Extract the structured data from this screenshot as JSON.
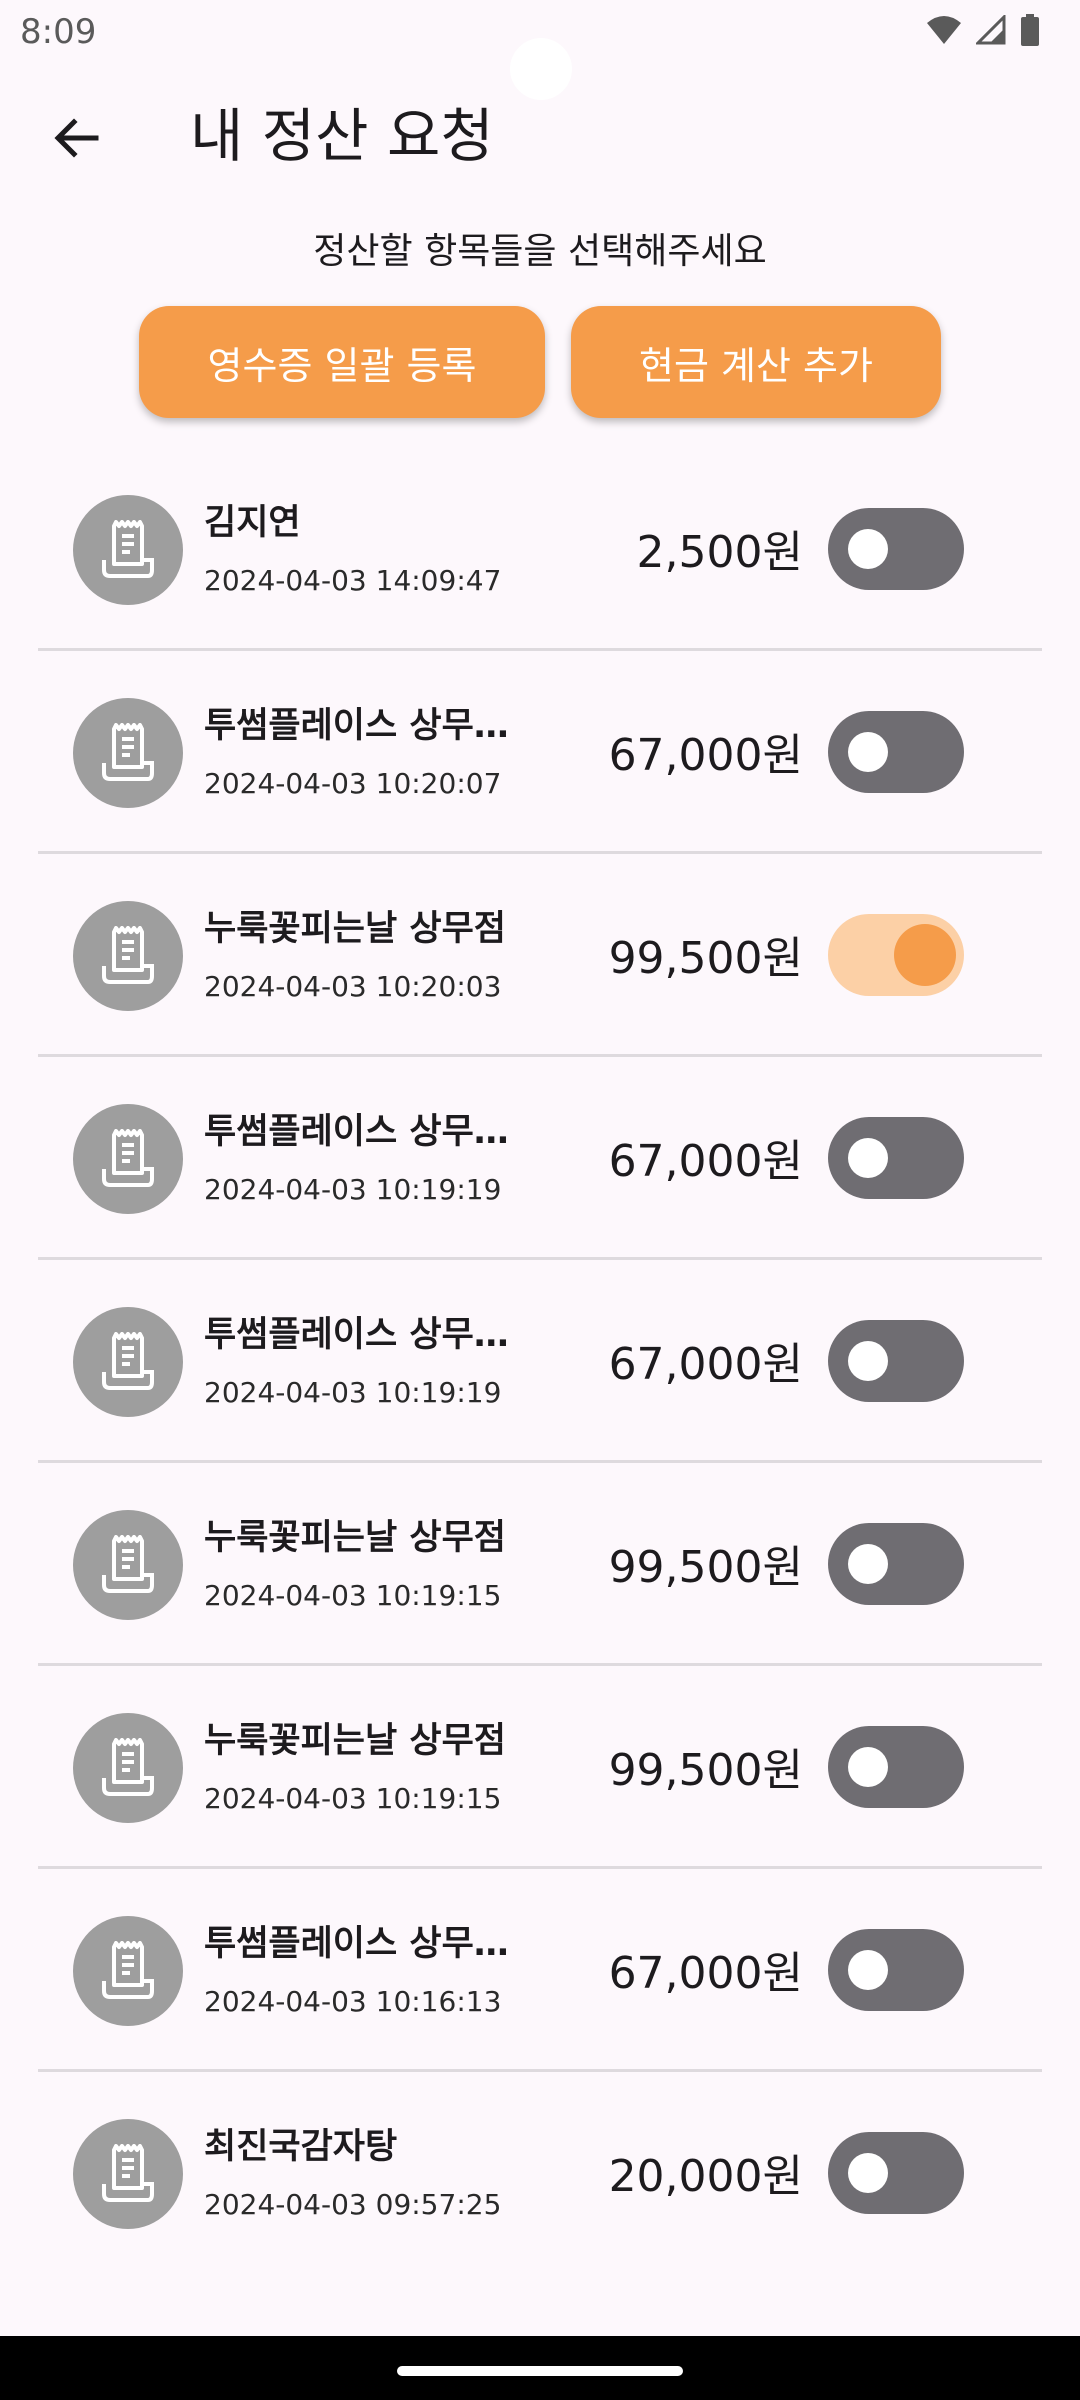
{
  "status": {
    "time": "8:09"
  },
  "header": {
    "title": "내 정산 요청"
  },
  "subtitle": "정산할 항목들을 선택해주세요",
  "buttons": {
    "receipt_bulk": "영수증 일괄 등록",
    "cash_add": "현금 계산 추가"
  },
  "colors": {
    "accent": "#f59c4a",
    "toggle_off": "#6f6d72",
    "avatar": "#9e9e9e"
  },
  "items": [
    {
      "merchant": "김지연",
      "datetime": "2024-04-03 14:09:47",
      "amount": "2,500원",
      "selected": false
    },
    {
      "merchant": "투썸플레이스 상무…",
      "datetime": "2024-04-03 10:20:07",
      "amount": "67,000원",
      "selected": false
    },
    {
      "merchant": "누룩꽃피는날 상무점",
      "datetime": "2024-04-03 10:20:03",
      "amount": "99,500원",
      "selected": true
    },
    {
      "merchant": "투썸플레이스 상무…",
      "datetime": "2024-04-03 10:19:19",
      "amount": "67,000원",
      "selected": false
    },
    {
      "merchant": "투썸플레이스 상무…",
      "datetime": "2024-04-03 10:19:19",
      "amount": "67,000원",
      "selected": false
    },
    {
      "merchant": "누룩꽃피는날 상무점",
      "datetime": "2024-04-03 10:19:15",
      "amount": "99,500원",
      "selected": false
    },
    {
      "merchant": "누룩꽃피는날 상무점",
      "datetime": "2024-04-03 10:19:15",
      "amount": "99,500원",
      "selected": false
    },
    {
      "merchant": "투썸플레이스 상무…",
      "datetime": "2024-04-03 10:16:13",
      "amount": "67,000원",
      "selected": false
    },
    {
      "merchant": "최진국감자탕",
      "datetime": "2024-04-03 09:57:25",
      "amount": "20,000원",
      "selected": false
    }
  ]
}
